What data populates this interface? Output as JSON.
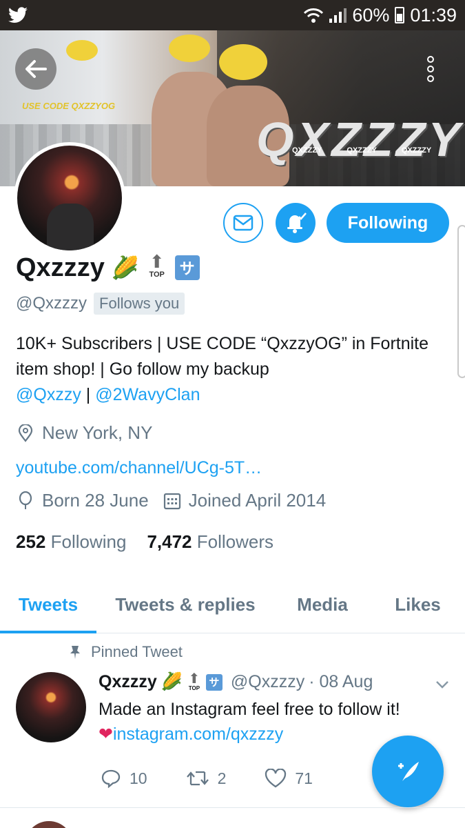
{
  "status_bar": {
    "app_icon": "twitter-bird-icon",
    "battery": "60%",
    "time": "01:39"
  },
  "banner": {
    "brand_text": "QXZZZY",
    "tagline": "USE CODE QXZZYOG",
    "socials": [
      "QXZZZY",
      "QXZZZY",
      "QXZZZY"
    ]
  },
  "profile": {
    "name": "Qxzzzy",
    "handle": "@Qxzzzy",
    "follows_you": "Follows you",
    "follow_button": "Following",
    "bio_text": "10K+ Subscribers | USE CODE “QxzzyOG” in Fortnite item shop! | Go follow my backup",
    "bio_link_1": "@Qxzzy",
    "bio_separator": " | ",
    "bio_link_2": "@2WavyClan",
    "location": "New York, NY",
    "url": "youtube.com/channel/UCg-5T…",
    "birthday": "Born 28 June",
    "joined": "Joined April 2014",
    "following_count": "252",
    "following_label": "Following",
    "followers_count": "7,472",
    "followers_label": "Followers"
  },
  "tabs": [
    {
      "label": "Tweets",
      "active": true
    },
    {
      "label": "Tweets & replies",
      "active": false
    },
    {
      "label": "Media",
      "active": false
    },
    {
      "label": "Likes",
      "active": false
    }
  ],
  "pinned_tweet": {
    "pinned_label": "Pinned Tweet",
    "author_name": "Qxzzzy",
    "author_handle": "@Qxzzzy",
    "date": "· 08 Aug",
    "text_line_1": "Made an Instagram feel free to follow it!",
    "link": "instagram.com/qxzzzy",
    "replies": "10",
    "retweets": "2",
    "likes": "71"
  },
  "colors": {
    "accent": "#1da1f2",
    "muted": "#657786",
    "text": "#14171a",
    "status_bar": "#2a2623"
  }
}
